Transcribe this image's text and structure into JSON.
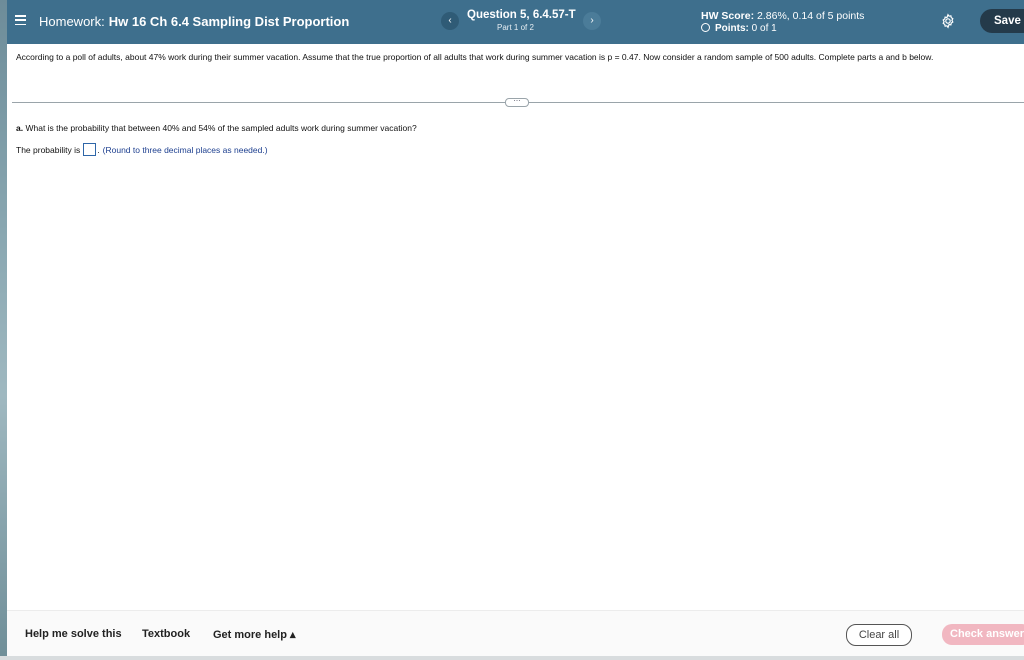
{
  "header": {
    "homework_label": "Homework:",
    "homework_name": "Hw 16 Ch 6.4 Sampling Dist Proportion",
    "question_title": "Question 5, 6.4.57-T",
    "question_part": "Part 1 of 2",
    "prev_glyph": "‹",
    "next_glyph": "›",
    "hw_score_label": "HW Score:",
    "hw_score_value": "2.86%, 0.14 of 5 points",
    "points_label": "Points:",
    "points_value": "0 of 1",
    "save_label": "Save"
  },
  "problem": {
    "text": "According to a poll of adults, about 47% work during their summer vacation. Assume that the true proportion of all adults that work during summer vacation is p = 0.47. Now consider a random sample of 500 adults. Complete parts a and b below."
  },
  "divider_dots": "⋯",
  "part_a": {
    "label": "a.",
    "question": "What is the probability that between 40% and 54% of the sampled adults work during summer vacation?",
    "answer_prefix": "The probability is",
    "answer_suffix": ".",
    "hint": "(Round to three decimal places as needed.)"
  },
  "footer": {
    "help_label": "Help me solve this",
    "textbook_label": "Textbook",
    "more_help_label": "Get more help ▴",
    "clear_label": "Clear all",
    "check_label": "Check answer"
  },
  "colors": {
    "header_bg": "#3e6f8d",
    "save_bg": "#243a4a",
    "check_bg": "#f1b7c1",
    "hint": "#1d3f8f"
  }
}
